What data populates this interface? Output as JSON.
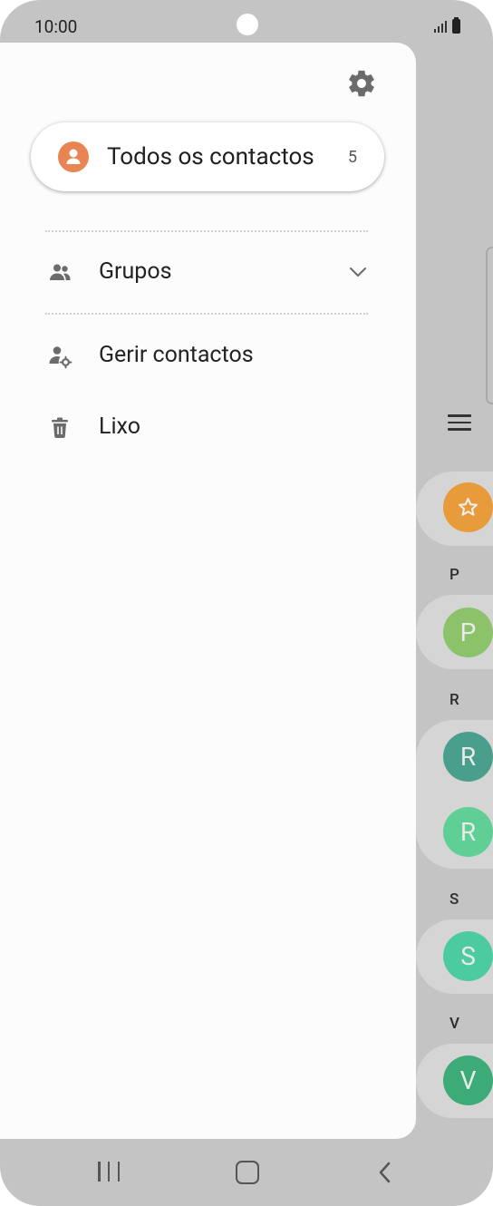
{
  "status_bar": {
    "time": "10:00"
  },
  "drawer": {
    "all_contacts": {
      "label": "Todos os contactos",
      "count": "5"
    },
    "items": [
      {
        "label": "Grupos",
        "icon": "group-icon",
        "expandable": true
      },
      {
        "label": "Gerir contactos",
        "icon": "manage-contacts-icon"
      },
      {
        "label": "Lixo",
        "icon": "trash-icon"
      }
    ]
  },
  "background_list": {
    "sections": [
      {
        "letter": "",
        "avatars": [
          {
            "initial": "",
            "color": "#e89b3a",
            "icon": "star-icon"
          }
        ]
      },
      {
        "letter": "P",
        "avatars": [
          {
            "initial": "P",
            "color": "#8bc26a"
          }
        ]
      },
      {
        "letter": "R",
        "avatars": [
          {
            "initial": "R",
            "color": "#4a9e8c"
          },
          {
            "initial": "R",
            "color": "#5fcf96"
          }
        ]
      },
      {
        "letter": "S",
        "avatars": [
          {
            "initial": "S",
            "color": "#4ccaa0"
          }
        ]
      },
      {
        "letter": "V",
        "avatars": [
          {
            "initial": "V",
            "color": "#3dab78"
          }
        ]
      }
    ]
  },
  "colors": {
    "accent_person": "#e88552",
    "scrim": "#c4c4c4"
  }
}
